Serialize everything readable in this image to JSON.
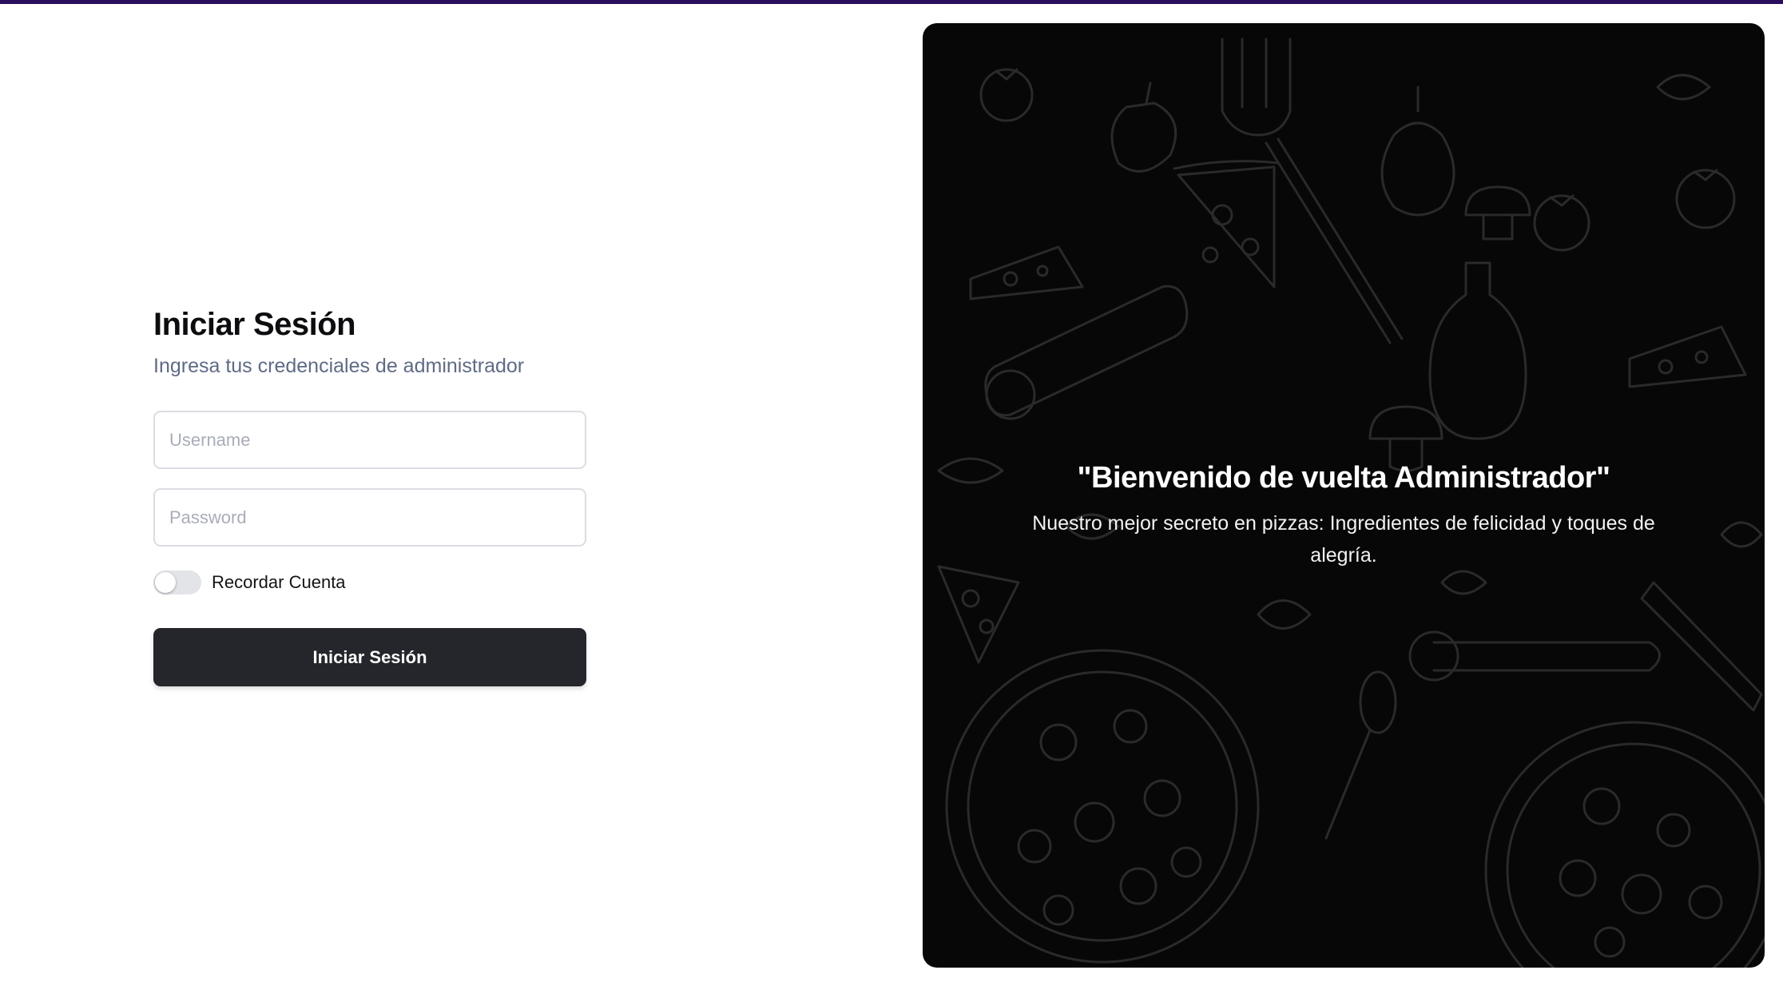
{
  "login": {
    "title": "Iniciar Sesión",
    "subtitle": "Ingresa tus credenciales de administrador",
    "username": {
      "value": "",
      "placeholder": "Username"
    },
    "password": {
      "value": "",
      "placeholder": "Password"
    },
    "remember": {
      "label": "Recordar Cuenta",
      "checked": false
    },
    "submit_label": "Iniciar Sesión"
  },
  "hero": {
    "quote": "\"Bienvenido de vuelta Administrador\"",
    "tagline": "Nuestro mejor secreto en pizzas: Ingredientes de felicidad y toques de alegría.",
    "background_icons": [
      "pizza-icon",
      "tomato-icon",
      "fork-icon",
      "mushroom-icon",
      "cheese-icon",
      "salami-icon",
      "oil-bottle-icon",
      "onion-icon",
      "pepper-icon",
      "leaf-icon",
      "spoon-icon"
    ]
  },
  "colors": {
    "accent_strip": "#2a0d5c",
    "button_bg": "#24262b",
    "hero_bg": "#070707",
    "subtitle": "#5f6b85"
  }
}
